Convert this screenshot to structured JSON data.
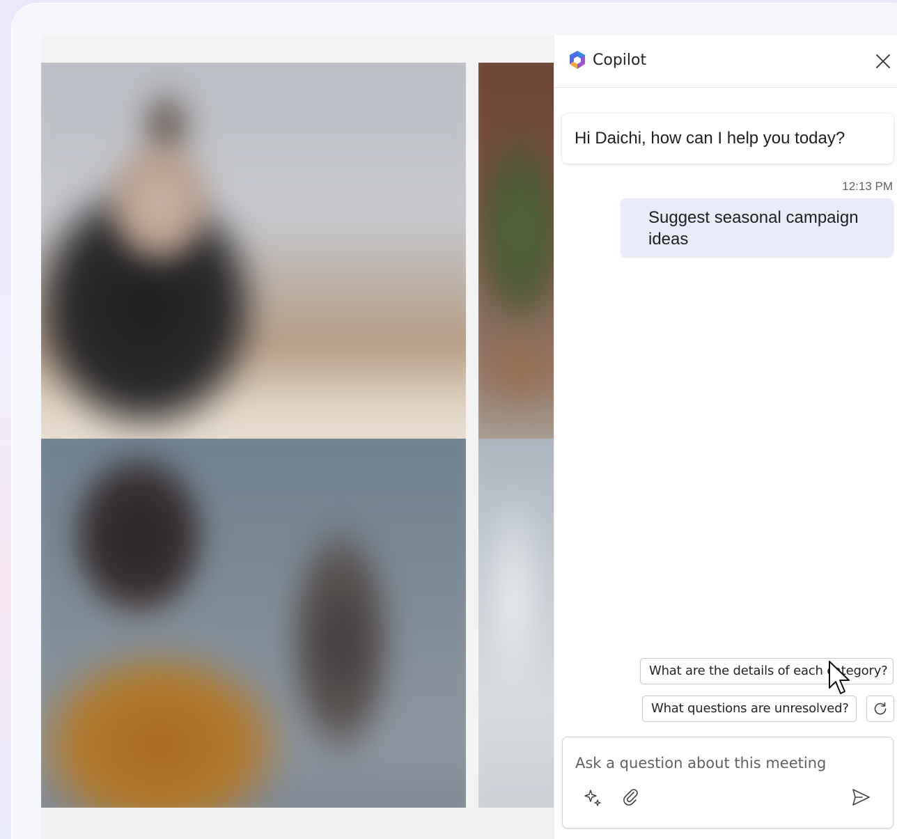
{
  "copilot": {
    "title": "Copilot",
    "messages": [
      {
        "role": "assistant",
        "text": "Hi Daichi, how can I help you today?"
      },
      {
        "role": "user",
        "time": "12:13 PM",
        "text": "Suggest seasonal campaign ideas"
      }
    ],
    "suggestions": [
      "What are the details of each category?",
      "What questions are unresolved?"
    ],
    "composer": {
      "placeholder": "Ask a question about this meeting"
    },
    "icons": {
      "logo": "copilot-logo",
      "close": "close-icon",
      "refresh": "refresh-icon",
      "prompts": "sparkle-icon",
      "attach": "paperclip-icon",
      "send": "send-icon"
    }
  },
  "colors": {
    "user_bubble": "#e8ebfa",
    "panel_bg": "#ffffff",
    "page_bg": "#f1eefc"
  }
}
